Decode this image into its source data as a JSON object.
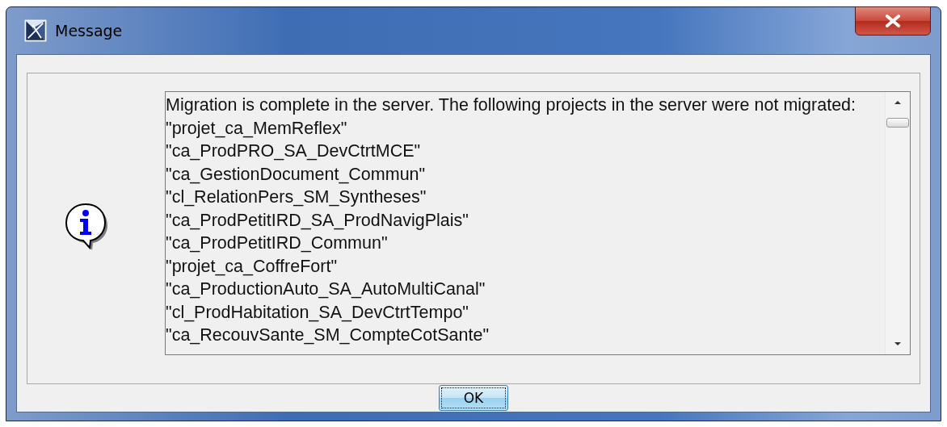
{
  "window": {
    "title": "Message"
  },
  "message": {
    "lines": [
      "Migration is complete in the server. The following projects in the server were not migrated:",
      "\"projet_ca_MemReflex\"",
      "\"ca_ProdPRO_SA_DevCtrtMCE\"",
      "\"ca_GestionDocument_Commun\"",
      "\"cl_RelationPers_SM_Syntheses\"",
      "\"ca_ProdPetitIRD_SA_ProdNavigPlais\"",
      "\"ca_ProdPetitIRD_Commun\"",
      "\"projet_ca_CoffreFort\"",
      "\"ca_ProductionAuto_SA_AutoMultiCanal\"",
      "\"cl_ProdHabitation_SA_DevCtrtTempo\"",
      "\"ca_RecouvSante_SM_CompteCotSante\""
    ]
  },
  "buttons": [
    {
      "label": "OK",
      "focused": true
    }
  ]
}
